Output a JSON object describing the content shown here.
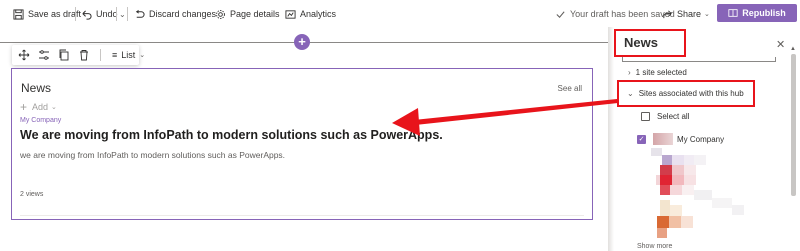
{
  "toolbar": {
    "save_as_draft": "Save as draft",
    "undo": "Undo",
    "discard_changes": "Discard changes",
    "page_details": "Page details",
    "analytics": "Analytics",
    "draft_status": "Your draft has been saved",
    "share": "Share",
    "republish": "Republish"
  },
  "section_toolbar": {
    "layout_label": "List"
  },
  "webpart": {
    "title": "News",
    "see_all": "See all",
    "add": "Add",
    "site_name": "My Company",
    "headline": "We are moving from InfoPath to modern solutions such as PowerApps.",
    "description": "we are moving from InfoPath to modern solutions such as PowerApps.",
    "views": "2 views"
  },
  "pane": {
    "title": "News",
    "site_selected": "1 site selected",
    "sites_associated": "Sites associated with this hub",
    "select_all": "Select all",
    "first_site": "My Company",
    "show_more": "Show more"
  },
  "colors": {
    "accent": "#8764b8",
    "annotation_red": "#e8141b"
  },
  "icons": [
    "save-icon",
    "undo-icon",
    "discard-icon",
    "gear-icon",
    "analytics-icon",
    "check-icon",
    "share-icon",
    "republish-icon",
    "plus-icon",
    "move-icon",
    "edit-icon",
    "copy-icon",
    "delete-icon",
    "list-icon",
    "close-icon",
    "chevron-right-icon",
    "chevron-down-icon"
  ]
}
